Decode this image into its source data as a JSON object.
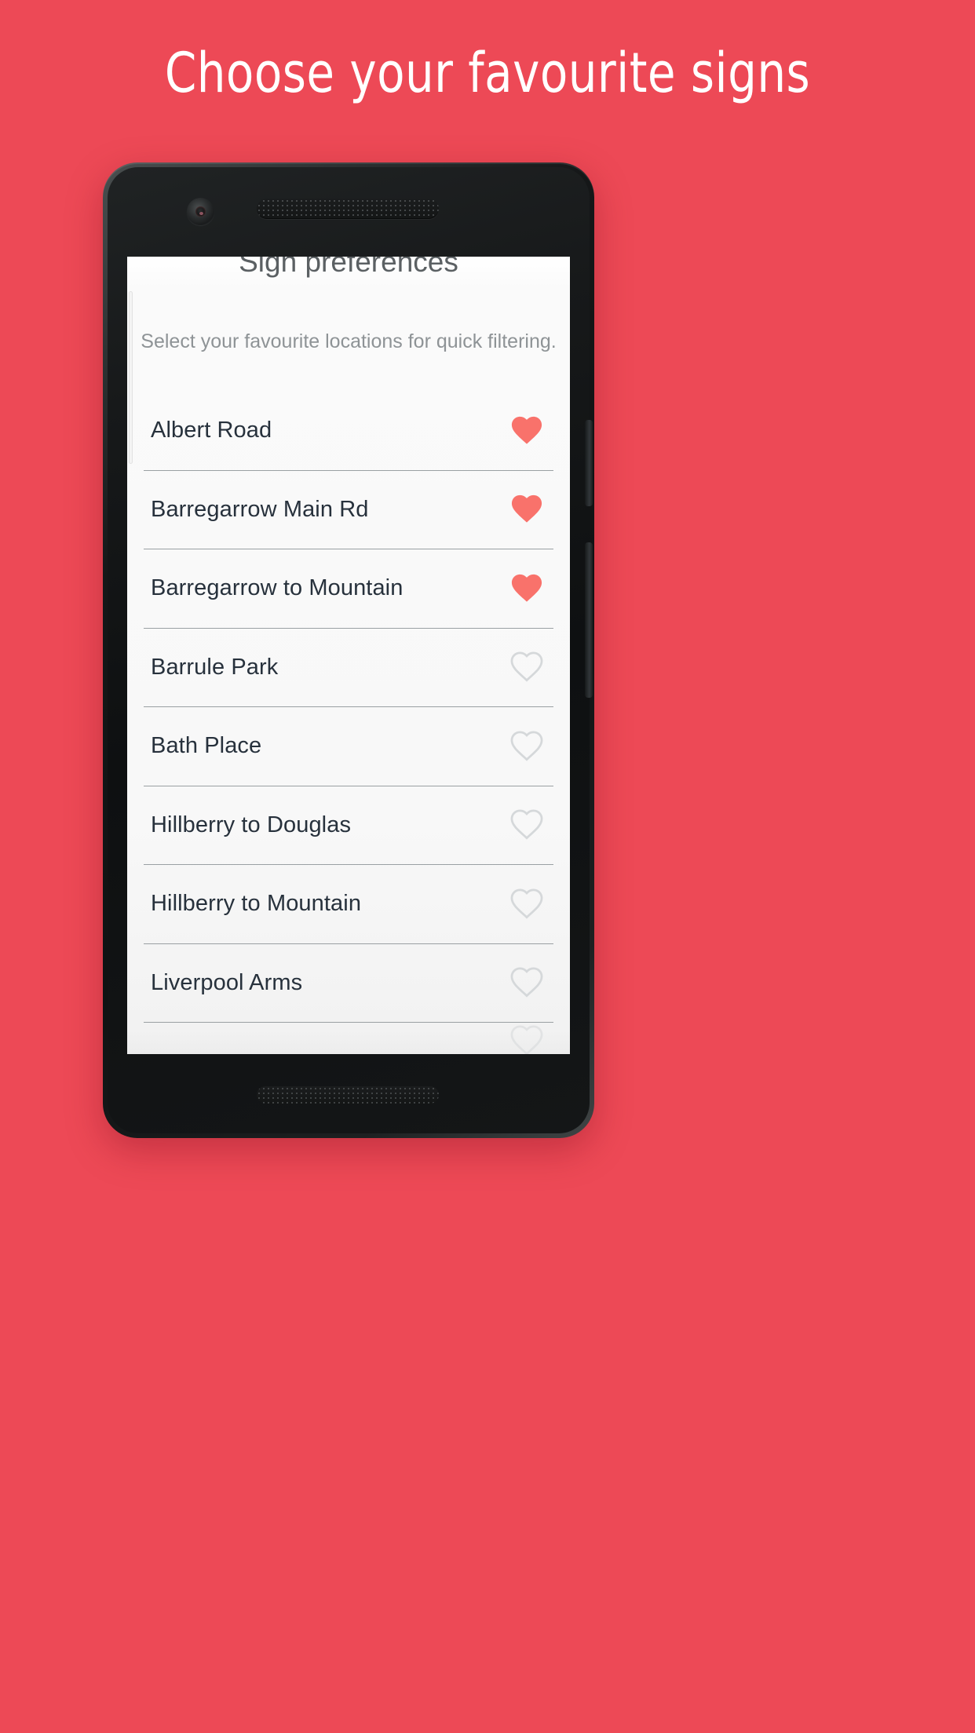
{
  "promo": {
    "headline": "Choose your favourite signs"
  },
  "colors": {
    "background": "#ED4956",
    "heart_filled": "#F9726B",
    "heart_outline": "#D5D8DA",
    "list_text": "#27313C",
    "title_text": "#5B6063",
    "subtitle_text": "#8E9396",
    "screen_background": "#F8F8F8",
    "divider": "#9AA0A3"
  },
  "screen": {
    "title": "Sign preferences",
    "subtitle": "Select your favourite locations for quick filtering.",
    "scrollbar": "scroll-indicator"
  },
  "list": {
    "items": [
      {
        "label": "Albert Road",
        "favourite": true,
        "icon": "heart-filled-icon"
      },
      {
        "label": "Barregarrow Main Rd",
        "favourite": true,
        "icon": "heart-filled-icon"
      },
      {
        "label": "Barregarrow to Mountain",
        "favourite": true,
        "icon": "heart-filled-icon"
      },
      {
        "label": "Barrule Park",
        "favourite": false,
        "icon": "heart-outline-icon"
      },
      {
        "label": "Bath Place",
        "favourite": false,
        "icon": "heart-outline-icon"
      },
      {
        "label": "Hillberry to Douglas",
        "favourite": false,
        "icon": "heart-outline-icon"
      },
      {
        "label": "Hillberry to Mountain",
        "favourite": false,
        "icon": "heart-outline-icon"
      },
      {
        "label": "Liverpool Arms",
        "favourite": false,
        "icon": "heart-outline-icon"
      }
    ],
    "partial_item": {
      "label": "",
      "favourite": false,
      "icon": "heart-outline-icon"
    }
  },
  "device": {
    "camera": "front-camera",
    "earpiece": "earpiece-speaker",
    "bottom_speaker": "bottom-speaker",
    "volume_button": "volume-rocker",
    "power_button": "power-button"
  }
}
